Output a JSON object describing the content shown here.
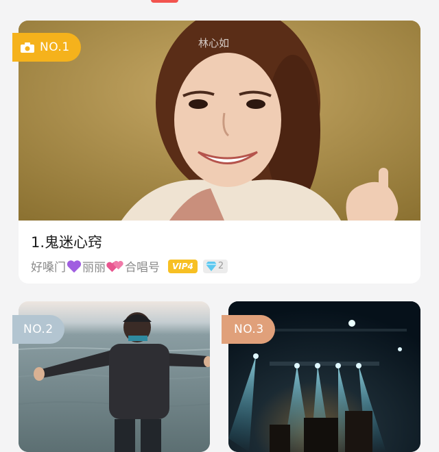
{
  "featured": {
    "rank": "NO.1",
    "watermark": "林心如",
    "title": "1.鬼迷心窍",
    "meta": {
      "part1": "好嗓门",
      "part2": "丽丽",
      "part3": "合唱号",
      "vip": "VIP4",
      "diamonds": "2"
    }
  },
  "cards": [
    {
      "rank": "NO.2"
    },
    {
      "rank": "NO.3"
    }
  ],
  "colors": {
    "accent": "#f2544f",
    "rank1": "#f5b21c",
    "rank2": "#b3c5d1",
    "rank3": "#e0a07a",
    "vip": "#f7c023"
  }
}
